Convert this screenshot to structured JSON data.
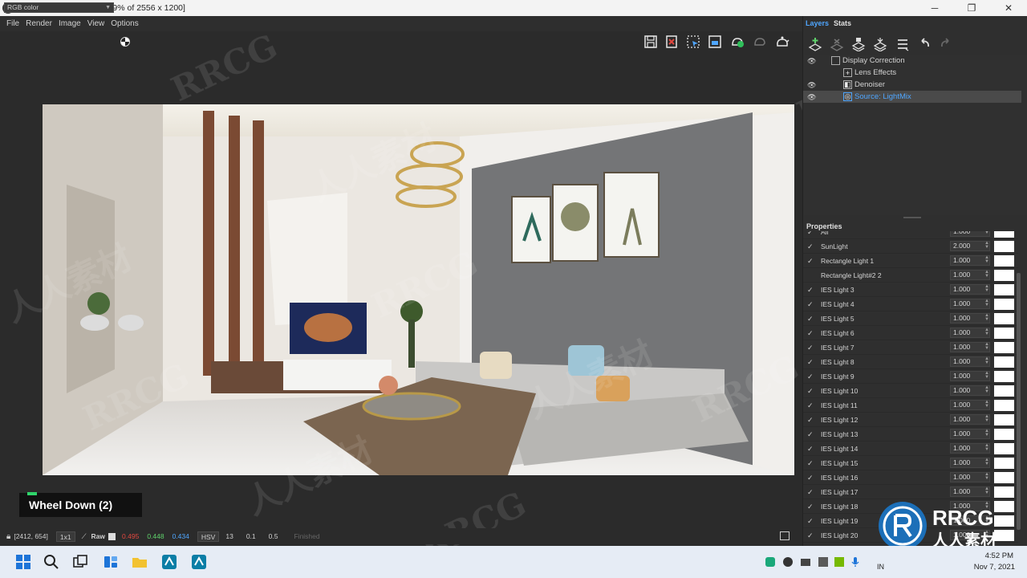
{
  "window": {
    "title": "V-Ray Frame Buffer - [57.9% of 2556 x 1200]",
    "minimize": "─",
    "maximize": "❐",
    "close": "✕"
  },
  "menu": [
    "File",
    "Render",
    "Image",
    "View",
    "Options"
  ],
  "channel": {
    "selected": "RGB color"
  },
  "right_panel": {
    "tabs": [
      "Layers",
      "Stats"
    ],
    "layers": [
      {
        "label": "Display Correction",
        "visible": true
      },
      {
        "label": "Lens Effects",
        "visible": false
      },
      {
        "label": "Denoiser",
        "visible": true
      },
      {
        "label": "Source: LightMix",
        "visible": true,
        "selected": true
      }
    ],
    "properties_title": "Properties",
    "lights": [
      {
        "name": "All",
        "value": "1.000",
        "checked": true
      },
      {
        "name": "SunLight",
        "value": "2.000",
        "checked": true
      },
      {
        "name": "Rectangle Light 1",
        "value": "1.000",
        "checked": true
      },
      {
        "name": "Rectangle Light#2 2",
        "value": "1.000",
        "checked": false
      },
      {
        "name": "IES Light 3",
        "value": "1.000",
        "checked": true
      },
      {
        "name": "IES Light 4",
        "value": "1.000",
        "checked": true
      },
      {
        "name": "IES Light 5",
        "value": "1.000",
        "checked": true
      },
      {
        "name": "IES Light 6",
        "value": "1.000",
        "checked": true
      },
      {
        "name": "IES Light 7",
        "value": "1.000",
        "checked": true
      },
      {
        "name": "IES Light 8",
        "value": "1.000",
        "checked": true
      },
      {
        "name": "IES Light 9",
        "value": "1.000",
        "checked": true
      },
      {
        "name": "IES Light 10",
        "value": "1.000",
        "checked": true
      },
      {
        "name": "IES Light 11",
        "value": "1.000",
        "checked": true
      },
      {
        "name": "IES Light 12",
        "value": "1.000",
        "checked": true
      },
      {
        "name": "IES Light 13",
        "value": "1.000",
        "checked": true
      },
      {
        "name": "IES Light 14",
        "value": "1.000",
        "checked": true
      },
      {
        "name": "IES Light 15",
        "value": "1.000",
        "checked": true
      },
      {
        "name": "IES Light 16",
        "value": "1.000",
        "checked": true
      },
      {
        "name": "IES Light 17",
        "value": "1.000",
        "checked": true
      },
      {
        "name": "IES Light 18",
        "value": "1.000",
        "checked": true
      },
      {
        "name": "IES Light 19",
        "value": "1.000",
        "checked": true
      },
      {
        "name": "IES Light 20",
        "value": "1.000",
        "checked": true
      }
    ]
  },
  "overlay": {
    "text": "Wheel Down (2)"
  },
  "statusbar": {
    "coords": "[2412, 654]",
    "zoom": "1x1",
    "raw_label": "Raw",
    "r": "0.495",
    "g": "0.448",
    "b": "0.434",
    "colorspace": "HSV",
    "h": "13",
    "s": "0.1",
    "v": "0.5",
    "status": "Finished"
  },
  "taskbar": {
    "time": "4:52 PM",
    "date": "Nov 7, 2021",
    "lang": "IN"
  },
  "watermark": {
    "text": "RRCG",
    "cn": "人人素材",
    "logo_text": "RRCG",
    "logo_cn": "人人素材"
  },
  "colors": {
    "accent": "#4fa6ff",
    "panel_bg": "#2f2f2f",
    "overlay_green": "#2fd46a"
  }
}
